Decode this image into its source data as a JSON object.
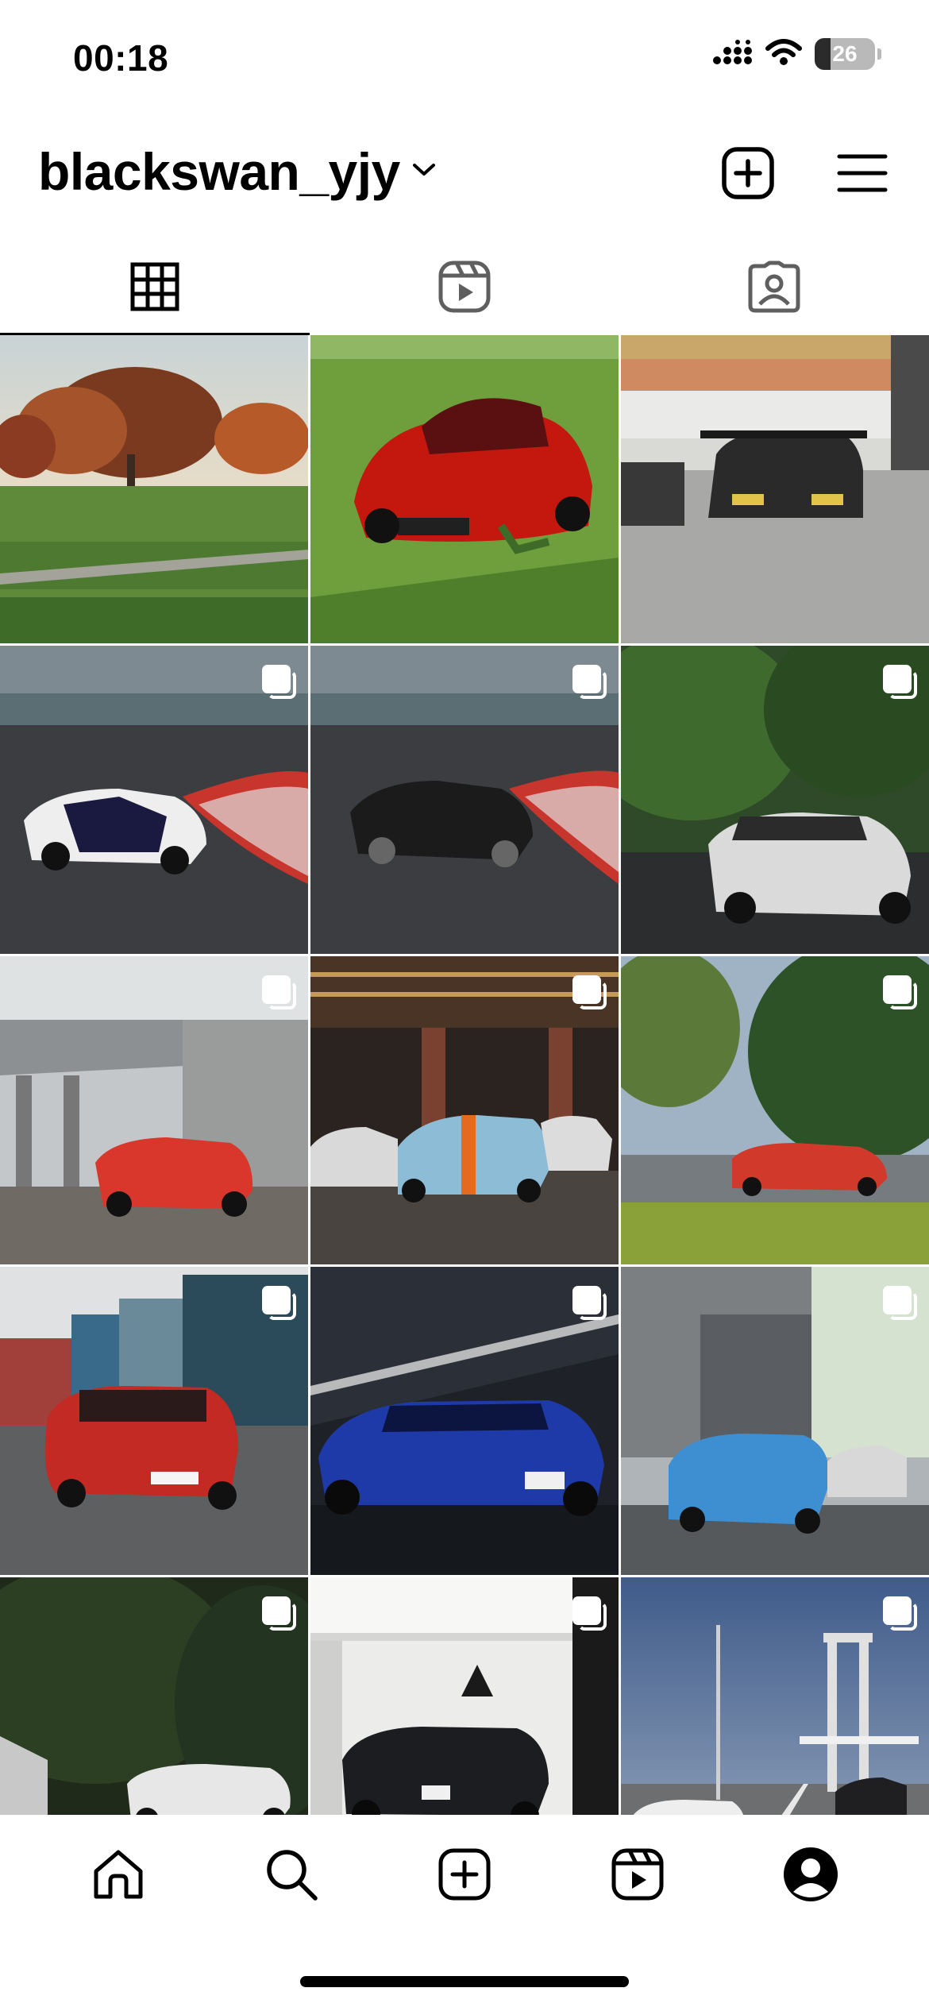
{
  "status_bar": {
    "time": "00:18",
    "battery": "26",
    "battery_level": 0.26
  },
  "header": {
    "username": "blackswan_yjy"
  },
  "icons": {
    "dropdown": "chevron-down-icon",
    "create": "plus-square-icon",
    "menu": "hamburger-menu-icon",
    "tab_grid": "grid-icon",
    "tab_reels": "reels-icon",
    "tab_tagged": "tagged-person-icon",
    "nav_home": "home-icon",
    "nav_search": "search-icon",
    "nav_create": "plus-square-icon",
    "nav_reels": "reels-icon",
    "nav_profile": "profile-icon"
  },
  "colors": {
    "text": "#000000",
    "background": "#ffffff"
  },
  "posts": [
    {
      "scene": "autumn park",
      "multi": false
    },
    {
      "scene": "red coupe in grass",
      "multi": false
    },
    {
      "scene": "grandstand with black porsche",
      "multi": false
    },
    {
      "scene": "white race porsche on track",
      "multi": true
    },
    {
      "scene": "black porsche on track",
      "multi": true
    },
    {
      "scene": "white porsche gt3 in forest",
      "multi": true
    },
    {
      "scene": "red porsche at building",
      "multi": true
    },
    {
      "scene": "gulf livery porsche in garage",
      "multi": true
    },
    {
      "scene": "red porsche by trees",
      "multi": true
    },
    {
      "scene": "red bmw e30 m3 at containers",
      "multi": true
    },
    {
      "scene": "blue skyline in tunnel",
      "multi": true
    },
    {
      "scene": "blue bmw m3 wagon street",
      "multi": true
    },
    {
      "scene": "white nsx in forest",
      "multi": true
    },
    {
      "scene": "black skyline in studio",
      "multi": true
    },
    {
      "scene": "nsx on bridge road",
      "multi": true
    }
  ]
}
